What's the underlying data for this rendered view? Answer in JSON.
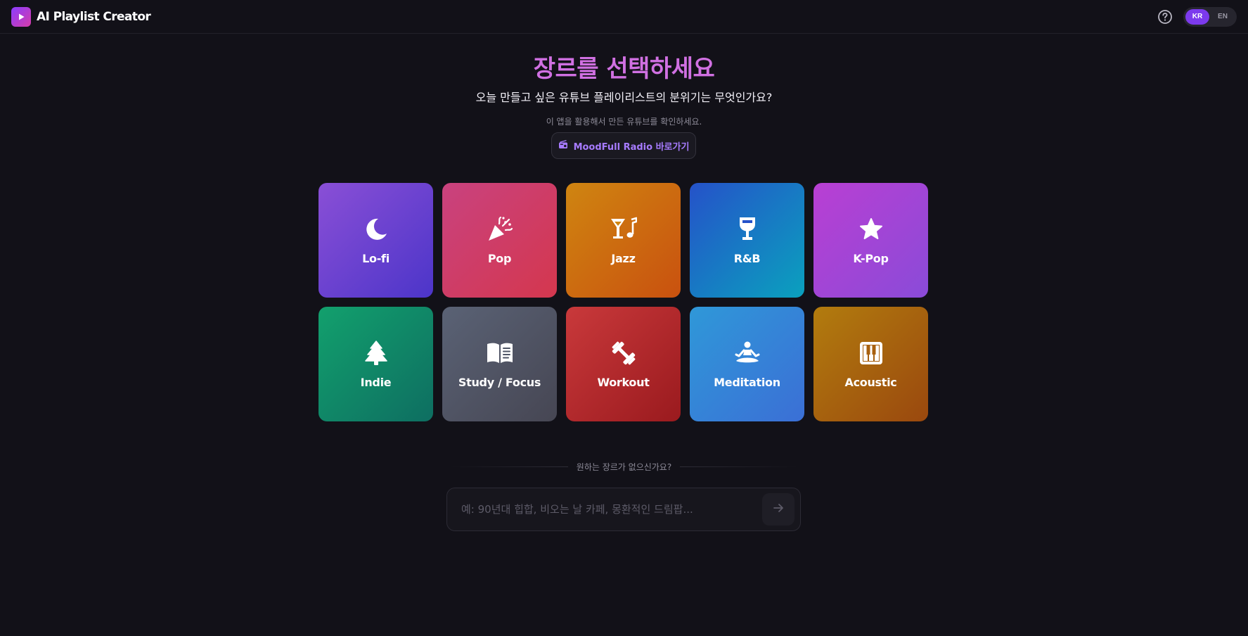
{
  "app": {
    "title": "AI Playlist Creator"
  },
  "header": {
    "help_icon": "question-circle-icon",
    "languages": [
      {
        "label": "KR",
        "active": true
      },
      {
        "label": "EN",
        "active": false
      }
    ]
  },
  "hero": {
    "title": "장르를 선택하세요",
    "subtitle": "오늘 만들고 싶은 유튜브 플레이리스트의 분위기는 무엇인가요?",
    "note": "이 앱을 활용해서 만든 유튜브를 확인하세요.",
    "radio_button": "MoodFull Radio 바로가기"
  },
  "genres": [
    {
      "label": "Lo-fi",
      "icon": "moon-icon",
      "colors": [
        "#8a4fd6",
        "#4c35c9"
      ]
    },
    {
      "label": "Pop",
      "icon": "party-popper-icon",
      "colors": [
        "#c9427f",
        "#d4374e"
      ]
    },
    {
      "label": "Jazz",
      "icon": "cocktail-music-icon",
      "colors": [
        "#cf8511",
        "#c9510f"
      ]
    },
    {
      "label": "R&B",
      "icon": "wine-glass-icon",
      "colors": [
        "#2552c9",
        "#0aa1be"
      ]
    },
    {
      "label": "K-Pop",
      "icon": "star-icon",
      "colors": [
        "#b93fd3",
        "#8a4bd8"
      ]
    },
    {
      "label": "Indie",
      "icon": "tree-icon",
      "colors": [
        "#12a06d",
        "#0e6e61"
      ]
    },
    {
      "label": "Study / Focus",
      "icon": "book-icon",
      "colors": [
        "#5a6275",
        "#464653"
      ]
    },
    {
      "label": "Workout",
      "icon": "dumbbell-icon",
      "colors": [
        "#c9393b",
        "#9a1a1e"
      ]
    },
    {
      "label": "Meditation",
      "icon": "meditation-icon",
      "colors": [
        "#2f98d8",
        "#3b6fd6"
      ]
    },
    {
      "label": "Acoustic",
      "icon": "piano-icon",
      "colors": [
        "#b27c0e",
        "#9a480e"
      ]
    }
  ],
  "custom": {
    "divider_text": "원하는 장르가 없으신가요?",
    "placeholder": "예: 90년대 힙합, 비오는 날 카페, 몽환적인 드림팝...",
    "value": "",
    "submit_icon": "arrow-right-icon"
  }
}
